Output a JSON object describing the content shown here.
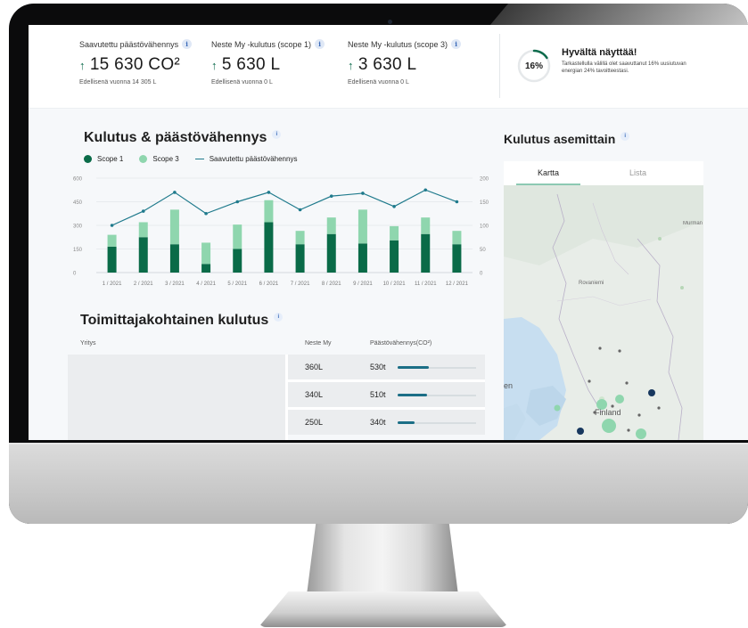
{
  "stats": [
    {
      "label": "Saavutettu päästövähennys",
      "value": "15 630 CO²",
      "previous": "Edellisenä vuonna 14 305 L"
    },
    {
      "label": "Neste My -kulutus (scope 1)",
      "value": "5 630 L",
      "previous": "Edellisenä vuonna 0 L"
    },
    {
      "label": "Neste My -kulutus (scope 3)",
      "value": "3 630 L",
      "previous": "Edellisenä vuonna 0 L"
    }
  ],
  "info_icon": "i",
  "goal": {
    "percent": "16%",
    "progress_fraction": 0.16,
    "title": "Hyvältä näyttää!",
    "text": "Tarkastellulla välillä olet saavuttanut 16% uusiutuvan energian 24% tavoitteestasi."
  },
  "consumption": {
    "title": "Kulutus & päästövähennys"
  },
  "colors": {
    "scope1": "#0a6b48",
    "scope3": "#8fd6ae",
    "line": "#1f7a8c",
    "accent": "#0d6b4c"
  },
  "chart_data": {
    "type": "bar",
    "categories": [
      "1 / 2021",
      "2 / 2021",
      "3 / 2021",
      "4 / 2021",
      "5 / 2021",
      "6 / 2021",
      "7 / 2021",
      "8 / 2021",
      "9 / 2021",
      "10 / 2021",
      "11 / 2021",
      "12 / 2021"
    ],
    "series": [
      {
        "name": "Scope 1",
        "type": "bar",
        "stack": "total",
        "axis": "left",
        "values": [
          165,
          225,
          180,
          55,
          150,
          320,
          180,
          245,
          185,
          205,
          245,
          180
        ]
      },
      {
        "name": "Scope 3",
        "type": "bar",
        "stack": "total",
        "axis": "left",
        "values": [
          75,
          95,
          220,
          135,
          155,
          140,
          85,
          105,
          215,
          90,
          105,
          85
        ]
      },
      {
        "name": "Saavutettu päästövähennys",
        "type": "line",
        "axis": "right",
        "values": [
          100,
          130,
          170,
          125,
          150,
          170,
          133,
          162,
          168,
          140,
          175,
          150
        ]
      }
    ],
    "ylim_left": [
      0,
      600
    ],
    "ylim_right": [
      0,
      200
    ],
    "yticks_left": [
      "0",
      "150",
      "300",
      "450",
      "600"
    ],
    "yticks_right": [
      "0",
      "50",
      "100",
      "150",
      "200"
    ],
    "legend": "top-left",
    "grid": true
  },
  "supplier": {
    "title": "Toimittajakohtainen kulutus",
    "headers": {
      "company": "Yritys",
      "neste": "Neste My",
      "reduction": "Päästövähennys(CO²)"
    },
    "rows": [
      {
        "company": "",
        "neste": "360L",
        "reduction": "530t",
        "bar_fraction": 0.4
      },
      {
        "company": "",
        "neste": "340L",
        "reduction": "510t",
        "bar_fraction": 0.38
      },
      {
        "company": "",
        "neste": "250L",
        "reduction": "340t",
        "bar_fraction": 0.22
      }
    ]
  },
  "map": {
    "title": "Kulutus asemittain",
    "tabs": [
      "Kartta",
      "Lista"
    ],
    "labels": {
      "rovaniemi": "Rovaniemi",
      "murmansk": "Murman Мурман",
      "finland": "Finland",
      "en": "en"
    }
  }
}
